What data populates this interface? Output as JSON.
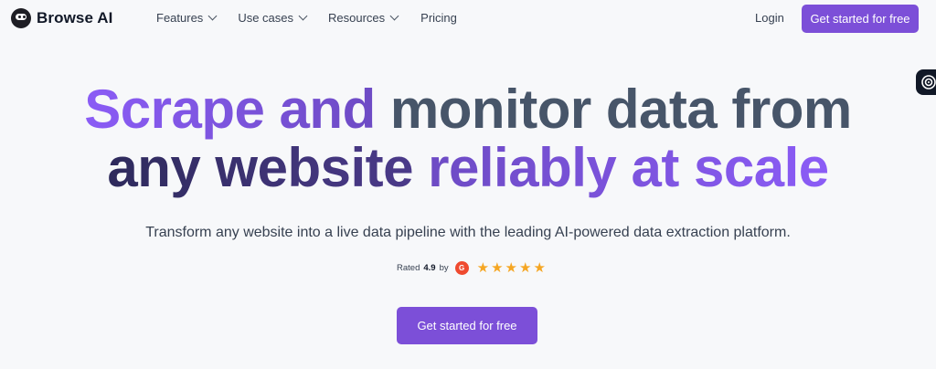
{
  "brand": {
    "name": "Browse AI"
  },
  "nav": {
    "features": "Features",
    "use_cases": "Use cases",
    "resources": "Resources",
    "pricing": "Pricing",
    "login": "Login",
    "cta": "Get started for free"
  },
  "hero": {
    "title_line1_part1": "Scrape and",
    "title_line1_part2": "monitor data from",
    "title_line2_part1": "any website",
    "title_line2_part2": "reliably at scale",
    "subtitle": "Transform any website into a live data pipeline with the leading AI-powered data extraction platform.",
    "rating_prefix": "Rated",
    "rating_value": "4.9",
    "rating_by": "by",
    "rating_source_icon": "g2-icon",
    "stars": 5,
    "cta": "Get started for free"
  },
  "colors": {
    "accent": "#7c4fd8",
    "title_slate": "#475569",
    "title_dark": "#2e2a5c",
    "star": "#f5a623",
    "g2_red": "#ef4a2f"
  }
}
